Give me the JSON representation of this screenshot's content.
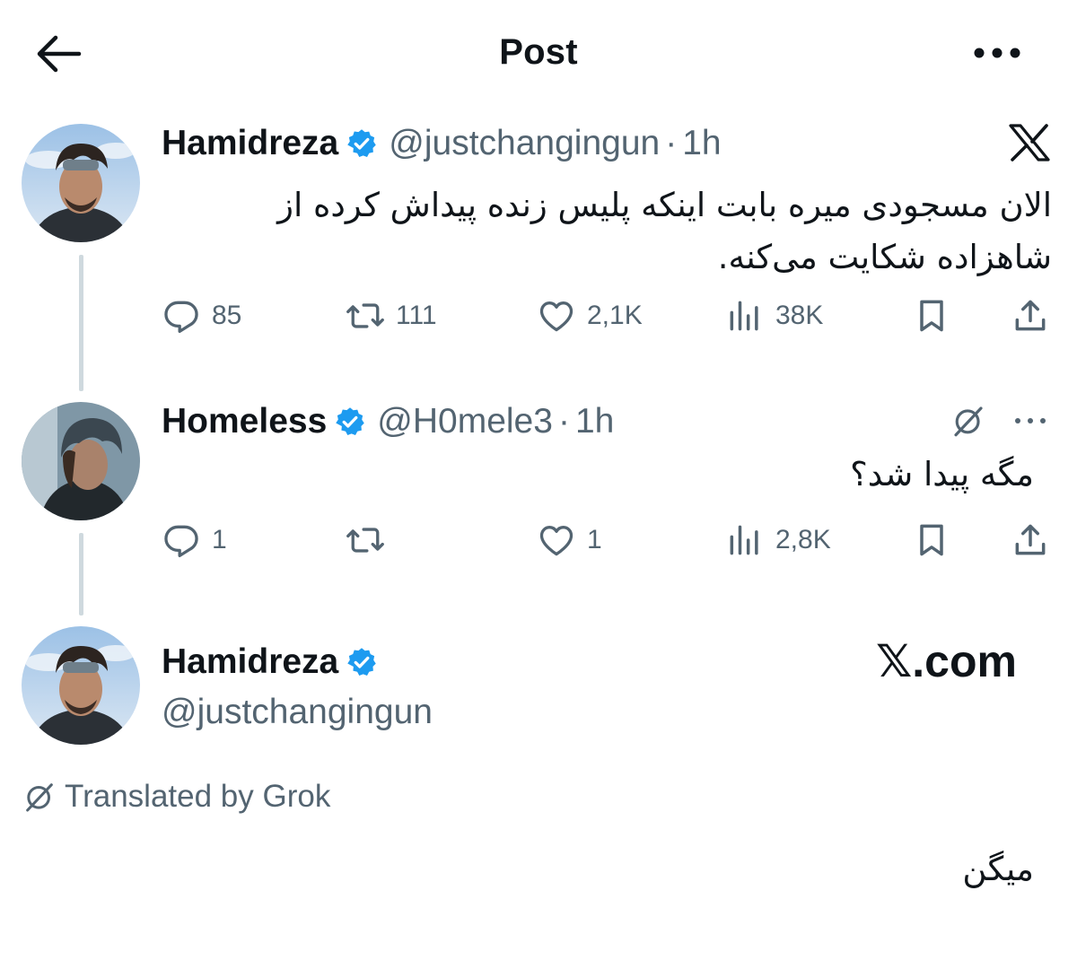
{
  "header": {
    "title": "Post"
  },
  "tweet1": {
    "name": "Hamidreza",
    "handle": "@justchangingun",
    "dot": "·",
    "time": "1h",
    "text_line1": "الان مسجودی میره بابت اینکه پلیس زنده پیداش کرده از",
    "text_line2": "شاهزاده شکایت می‌کنه.",
    "replies": "85",
    "reposts": "111",
    "likes": "2,1K",
    "views": "38K"
  },
  "tweet2": {
    "name": "Homeless",
    "handle": "@H0mele3",
    "dot": "·",
    "time": "1h",
    "text": "مگه پیدا شد؟",
    "replies": "1",
    "reposts": "",
    "likes": "1",
    "views": "2,8K"
  },
  "tweet3": {
    "name": "Hamidreza",
    "handle": "@justchangingun",
    "watermark": "𝕏.com",
    "translated_label": "Translated by Grok",
    "text": "میگن"
  },
  "colors": {
    "verified_blue": "#1d9bf0",
    "secondary_text": "#536471",
    "thread_line": "#cfd9de"
  },
  "icons": [
    "back-arrow-icon",
    "more-icon",
    "verified-badge-icon",
    "x-logo-icon",
    "grok-icon",
    "reply-icon",
    "repost-icon",
    "like-icon",
    "views-icon",
    "bookmark-icon",
    "share-icon"
  ]
}
